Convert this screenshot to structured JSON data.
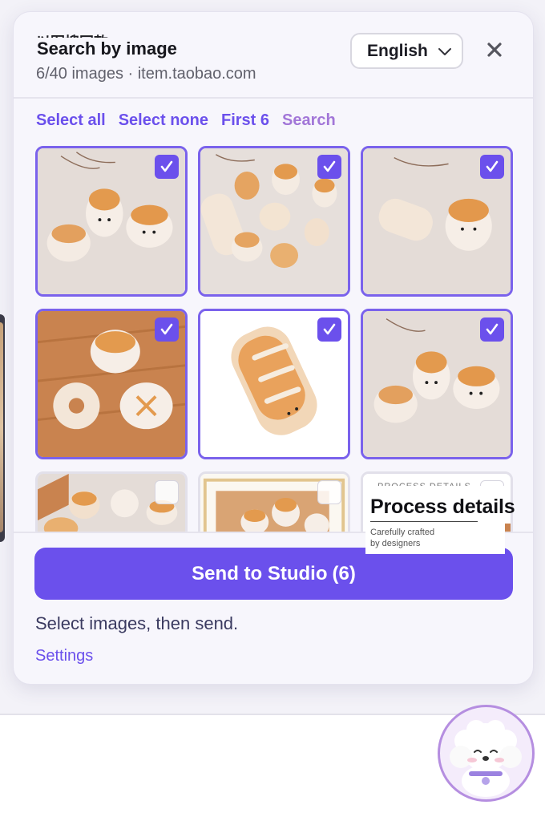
{
  "window": {
    "cut_header_text": "以图搜同款",
    "title": "Search by image",
    "subtitle": "6/40 images · item.taobao.com"
  },
  "language": {
    "selected": "English",
    "icon": "chevron-down-icon"
  },
  "close": {
    "icon": "close-icon",
    "glyph": "✕"
  },
  "actions": {
    "select_all": "Select all",
    "select_none": "Select none",
    "first_n": "First 6",
    "search": "Search"
  },
  "images": [
    {
      "selected": true,
      "scene": "buns on linen"
    },
    {
      "selected": true,
      "scene": "bun set on linen"
    },
    {
      "selected": true,
      "scene": "loaf and toast on linen"
    },
    {
      "selected": true,
      "scene": "buns on wood"
    },
    {
      "selected": true,
      "scene": "loaf on white"
    },
    {
      "selected": true,
      "scene": "buns on linen"
    },
    {
      "selected": false,
      "scene": "buns on wood tray"
    },
    {
      "selected": false,
      "scene": "framed buns"
    },
    {
      "selected": false,
      "scene": "process details graphic"
    }
  ],
  "check_glyph": "✓",
  "process_card": {
    "heading": "Process details",
    "line1": "Carefully crafted",
    "line2": "by designers",
    "cut_text": "PROCESS DETAILS"
  },
  "send_button": {
    "label": "Send to Studio",
    "count": "(6)"
  },
  "hint": "Select images, then send.",
  "settings": "Settings",
  "colors": {
    "accent": "#6b50ec",
    "accent_secondary": "#a276d8",
    "panel_bg": "#f7f6fc"
  },
  "avatar": {
    "icon": "dog-avatar-icon"
  }
}
